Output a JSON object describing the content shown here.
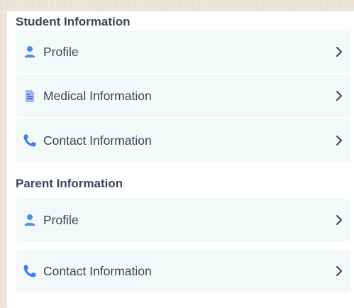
{
  "student_section": {
    "title": "Student Information",
    "items": [
      {
        "label": "Profile",
        "icon": "person-icon"
      },
      {
        "label": "Medical Information",
        "icon": "medical-document-icon"
      },
      {
        "label": "Contact Information",
        "icon": "phone-icon"
      }
    ]
  },
  "parent_section": {
    "title": "Parent Information",
    "items": [
      {
        "label": "Profile",
        "icon": "person-icon"
      },
      {
        "label": "Contact Information",
        "icon": "phone-icon"
      }
    ]
  },
  "colors": {
    "accent": "#4b8ef0",
    "text": "#3a4453",
    "card_bg": "#f3f9f9",
    "panel_bg": "#ffffff",
    "page_bg": "#ebe5dc"
  }
}
